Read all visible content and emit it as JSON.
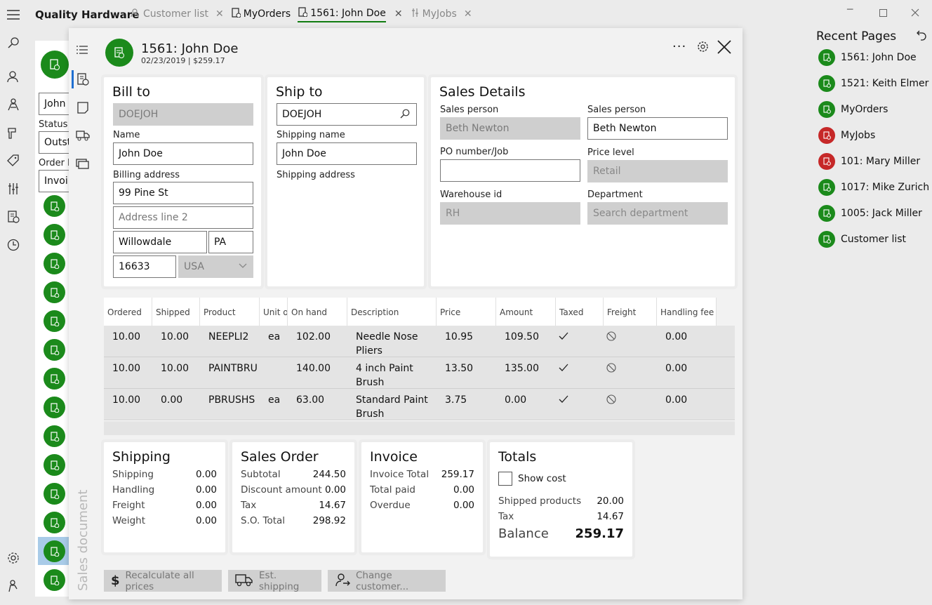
{
  "app": {
    "title": "Quality Hardware"
  },
  "tabs": [
    {
      "label": "Customer list"
    },
    {
      "label": "MyOrders"
    },
    {
      "label": "1561: John Doe"
    },
    {
      "label": "MyJobs"
    }
  ],
  "left_list": {
    "search_value": "John",
    "status_label": "Status",
    "status_value": "Outst",
    "order_by_label": "Order b",
    "order_by_value": "Invoi"
  },
  "doc": {
    "title": "1561: John Doe",
    "subtitle": "02/23/2019 | $259.17",
    "vertical_label": "Sales document"
  },
  "bill_to": {
    "title": "Bill to",
    "customer_id": "DOEJOH",
    "name_label": "Name",
    "name_value": "John Doe",
    "address_label": "Billing address",
    "address1": "99 Pine St",
    "address2_placeholder": "Address line 2",
    "city": "Willowdale",
    "state": "PA",
    "zip": "16633",
    "country": "USA"
  },
  "ship_to": {
    "title": "Ship to",
    "customer_id": "DOEJOH",
    "name_label": "Shipping name",
    "name_value": "John Doe",
    "address_label": "Shipping address"
  },
  "sales_details": {
    "title": "Sales Details",
    "sales_person_label_1": "Sales person",
    "sales_person_value_1": "Beth Newton",
    "sales_person_label_2": "Sales person",
    "sales_person_value_2": "Beth Newton",
    "po_label": "PO number/Job",
    "po_value": "",
    "price_level_label": "Price level",
    "price_level_value": "Retail",
    "warehouse_label": "Warehouse id",
    "warehouse_value": "RH",
    "department_label": "Department",
    "department_placeholder": "Search department"
  },
  "grid": {
    "columns": [
      "Ordered",
      "Shipped",
      "Product",
      "Unit of",
      "On hand",
      "Description",
      "Price",
      "Amount",
      "Taxed",
      "Freight",
      "Handling fee"
    ],
    "rows": [
      {
        "ordered": "10.00",
        "shipped": "10.00",
        "product": "NEEPLI2",
        "unit": "ea",
        "on_hand": "102.00",
        "desc1": "Needle Nose",
        "desc2": "Pliers",
        "price": "10.95",
        "amount": "109.50",
        "handling": "0.00"
      },
      {
        "ordered": "10.00",
        "shipped": "10.00",
        "product": "PAINTBRU",
        "unit": "",
        "on_hand": "140.00",
        "desc1": "4 inch Paint",
        "desc2": "Brush",
        "price": "13.50",
        "amount": "135.00",
        "handling": "0.00"
      },
      {
        "ordered": "10.00",
        "shipped": "0.00",
        "product": "PBRUSHS",
        "unit": "ea",
        "on_hand": "63.00",
        "desc1": "Standard Paint",
        "desc2": "Brush",
        "price": "3.75",
        "amount": "0.00",
        "handling": "0.00"
      }
    ]
  },
  "shipping": {
    "title": "Shipping",
    "rows": [
      {
        "label": "Shipping",
        "value": "0.00"
      },
      {
        "label": "Handling",
        "value": "0.00"
      },
      {
        "label": "Freight",
        "value": "0.00"
      },
      {
        "label": "Weight",
        "value": "0.00"
      }
    ]
  },
  "sales_order": {
    "title": "Sales Order",
    "rows": [
      {
        "label": "Subtotal",
        "value": "244.50"
      },
      {
        "label": "Discount amount",
        "value": "0.00"
      },
      {
        "label": "Tax",
        "value": "14.67"
      },
      {
        "label": "S.O. Total",
        "value": "298.92"
      }
    ]
  },
  "invoice": {
    "title": "Invoice",
    "rows": [
      {
        "label": "Invoice Total",
        "value": "259.17"
      },
      {
        "label": "Total paid",
        "value": "0.00"
      },
      {
        "label": "Overdue",
        "value": "0.00"
      }
    ]
  },
  "totals": {
    "title": "Totals",
    "show_cost_label": "Show cost",
    "shipped_label": "Shipped products",
    "shipped_value": "20.00",
    "tax_label": "Tax",
    "tax_value": "14.67",
    "balance_label": "Balance",
    "balance_value": "259.17"
  },
  "actions": {
    "recalc": "Recalculate all prices",
    "est_shipping": "Est. shipping",
    "change_customer": "Change customer..."
  },
  "recent": {
    "title": "Recent Pages",
    "items": [
      {
        "label": "1561: John Doe",
        "color": "#1b8a1b"
      },
      {
        "label": "1521: Keith Elmer",
        "color": "#1b8a1b"
      },
      {
        "label": "MyOrders",
        "color": "#1b8a1b"
      },
      {
        "label": "MyJobs",
        "color": "#c62828"
      },
      {
        "label": "101: Mary Miller",
        "color": "#c62828"
      },
      {
        "label": "1017: Mike Zurich",
        "color": "#1b8a1b"
      },
      {
        "label": "1005: Jack Miller",
        "color": "#1b8a1b"
      },
      {
        "label": "Customer list",
        "color": "#1b8a1b"
      }
    ]
  }
}
